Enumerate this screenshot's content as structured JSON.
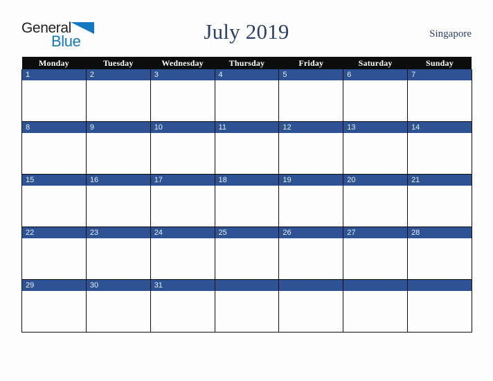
{
  "brand": {
    "name_part1": "General",
    "name_part2": "Blue",
    "triangle_color": "#1179c0",
    "text_color": "#1f1f1f"
  },
  "header": {
    "title": "July 2019",
    "country": "Singapore",
    "title_color": "#2b4068"
  },
  "calendar": {
    "month": "July",
    "year": "2019",
    "weekday_headers": [
      "Monday",
      "Tuesday",
      "Wednesday",
      "Thursday",
      "Friday",
      "Saturday",
      "Sunday"
    ],
    "header_bg": "#0d0d0d",
    "date_bar_bg": "#2e5395",
    "date_text_color": "#e9eef6",
    "cell_bg": "#fdfdfd",
    "border_color": "#0a0a0a",
    "weeks": [
      {
        "dates": [
          "1",
          "2",
          "3",
          "4",
          "5",
          "6",
          "7"
        ]
      },
      {
        "dates": [
          "8",
          "9",
          "10",
          "11",
          "12",
          "13",
          "14"
        ]
      },
      {
        "dates": [
          "15",
          "16",
          "17",
          "18",
          "19",
          "20",
          "21"
        ]
      },
      {
        "dates": [
          "22",
          "23",
          "24",
          "25",
          "26",
          "27",
          "28"
        ]
      },
      {
        "dates": [
          "29",
          "30",
          "31",
          "",
          "",
          "",
          ""
        ]
      }
    ]
  }
}
